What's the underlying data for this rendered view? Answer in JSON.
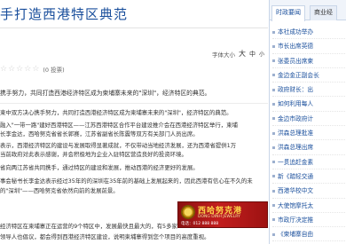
{
  "article": {
    "headline": "手打造西港特区典范",
    "rating_stars": [
      "☆",
      "☆",
      "☆",
      "☆",
      "☆"
    ],
    "rating_count": "(0 投票)",
    "font_size": {
      "label": "字体大小",
      "big": "大",
      "medium": "中",
      "small": "小"
    },
    "summary": "携手努力，共同打造西港经济特区成为柬埔寨未来的\"深圳\"，经济特区的典范。",
    "paragraphs": [
      "柬中双方决心携手努力，共同打造西港经济特区成为柬埔寨未来的\"深圳\"，经济特区的典范。",
      "融入\"一带一路\"建好西港特区——江苏西港特区合作平台建设推介会在西港经济特区举行，柬埔",
      "长李金达，西哈努克省省长郭赛，江苏省副省长陈震等双方有关部门人员出席。",
      "表示，西港经济特区的建设与发展取得显著成就，不仅带动当地经济发展，还为西港省提供1万",
      "当前政府对此表示感谢，并会积极地为企业入驻特区营造良好的投资环境。",
      "省向两江苏省共同携手，通过特区的建设和发展，推动西港的经济更好的发展。",
      "事会秘书长李金达表示经过35年的的深圳在35年前的基础上发展起来的，因此西港有信心在不久的未",
      "的\"深圳\"——西哈努克省依然向前的发展前景。",
      "经济特区在柬埔寨正在运营的9个特区中，发展最快且最大的，有5多家企业已得到，西港有特区以南",
      "领导人也倡议，都会得到西港经济特区建设，说明柬埔寨得到您个项目的高度重视。"
    ]
  },
  "ad": {
    "title": "西哈努克港",
    "subtitle": "DONG DINH JEWELRY",
    "phone": "电话：012 888 888"
  },
  "sidebar": {
    "tabs": [
      "时政要闻",
      "商业经"
    ],
    "news": [
      "本社成功举办",
      "市长出席英德",
      "张委员出席柬",
      "金边金正副会长",
      "政府财长：出",
      "如何利用每人",
      "金边市政府计",
      "洪森总理批准",
      "洪森总理出席",
      "一贯追赶金素",
      "新《踏轻交通",
      "西港华校中文",
      "大使馆摩托太",
      "市政厅决定推",
      "《柬埔寨自由"
    ]
  }
}
